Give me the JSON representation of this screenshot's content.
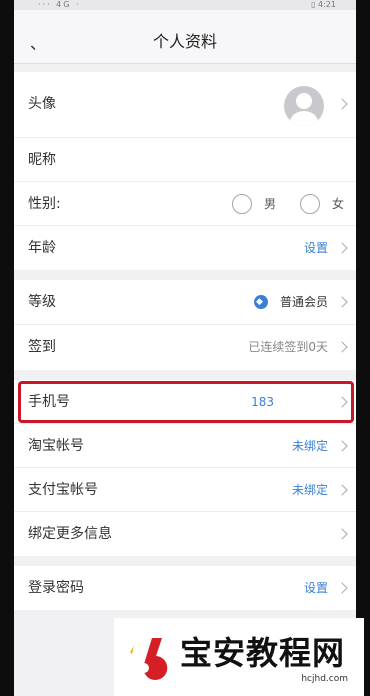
{
  "status": {
    "left": "··· 4G ·",
    "right": "▯ 4:21"
  },
  "nav": {
    "back": "、",
    "title": "个人资料"
  },
  "profile": {
    "avatar_label": "头像",
    "nickname_label": "昵称",
    "gender_label": "性别:",
    "gender_options": [
      "男",
      "女"
    ],
    "age_label": "年龄",
    "age_value": "设置"
  },
  "account": {
    "level_label": "等级",
    "level_value": "普通会员",
    "checkin_label": "签到",
    "checkin_value": "已连续签到0天"
  },
  "bindings": {
    "phone_label": "手机号",
    "phone_value": "183",
    "taobao_label": "淘宝帐号",
    "taobao_value": "未绑定",
    "alipay_label": "支付宝帐号",
    "alipay_value": "未绑定",
    "more_label": "绑定更多信息"
  },
  "security": {
    "password_label": "登录密码",
    "password_value": "设置"
  },
  "watermark": {
    "text": "宝安教程网",
    "url": "hcjhd.com"
  },
  "colors": {
    "accent": "#3a7fd5",
    "highlight": "#c8162b",
    "watermark_logo": "#d41f26"
  }
}
